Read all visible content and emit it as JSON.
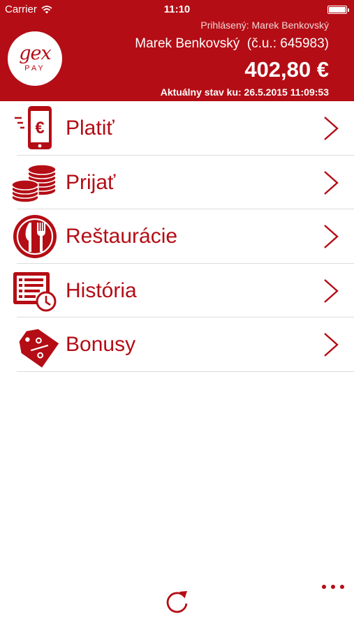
{
  "status_bar": {
    "carrier": "Carrier",
    "time": "11:10"
  },
  "header": {
    "logged_in": "Prihlásený: Marek Benkovský",
    "user": "Marek Benkovský  (č.u.: 645983)",
    "balance": "402,80 €",
    "as_of": "Aktuálny stav ku: 26.5.2015 11:09:53"
  },
  "logo": {
    "top": "gex",
    "bottom": "PAY"
  },
  "menu": [
    {
      "label": "Platiť",
      "icon": "pay-phone-euro-icon"
    },
    {
      "label": "Prijať",
      "icon": "coins-icon"
    },
    {
      "label": "Reštaurácie",
      "icon": "restaurant-icon"
    },
    {
      "label": "História",
      "icon": "history-icon"
    },
    {
      "label": "Bonusy",
      "icon": "bonus-tag-icon"
    }
  ],
  "colors": {
    "accent": "#b40d15",
    "divider": "#dcdcdc",
    "background": "#ffffff"
  }
}
